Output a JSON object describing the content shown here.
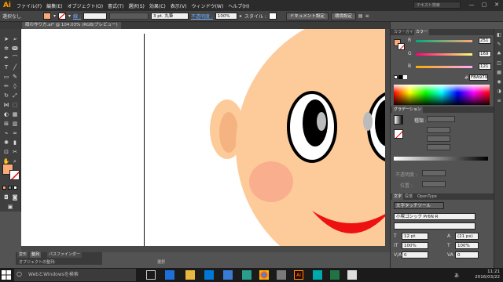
{
  "app": {
    "logo": "Ai"
  },
  "menubar": {
    "items": [
      "ファイル(F)",
      "編集(E)",
      "オブジェクト(O)",
      "書式(T)",
      "選択(S)",
      "効果(C)",
      "表示(V)",
      "ウィンドウ(W)",
      "ヘルプ(H)"
    ],
    "search_placeholder": "テキスト検索",
    "win_controls": [
      "—",
      "▢",
      "✕"
    ]
  },
  "control_bar": {
    "selection_label": "選択なし",
    "stroke_label": "線 :",
    "stroke_style": "3 pt. 丸筆",
    "opacity_label": "不透明度 :",
    "opacity_value": "100%",
    "style_label": "スタイル :",
    "doc_setup_button": "ドキュメント設定",
    "preferences_button": "環境設定"
  },
  "document_tab": {
    "label": "顔の作り方.ai* @ 104.03% (RGB/プレビュー)"
  },
  "color_panel": {
    "tabs": [
      "カラーガイド",
      "カラー"
    ],
    "r_label": "R",
    "r_value": "251",
    "g_label": "G",
    "g_value": "169",
    "b_label": "B",
    "b_value": "121",
    "hex_label": "#",
    "hex_value": "FBA979",
    "fill_color": "#FBA979"
  },
  "gradient_panel": {
    "tabs": [
      "グラデーション"
    ],
    "type_label": "種類 :",
    "opacity_label": "不透明度 :",
    "position_label": "位置 :"
  },
  "character_panel": {
    "tabs": [
      "文字",
      "段落",
      "OpenType"
    ],
    "touch_tool": "文字タッチツール",
    "font_name": "小塚ゴシック Pr6N R",
    "font_style": "",
    "font_size": "12 pt",
    "leading": "(21 px)",
    "h_scale": "100%",
    "v_scale": "100%",
    "tracking": "0",
    "kerning": "0"
  },
  "bottom_panels": {
    "tabs": [
      "変形",
      "整列",
      "パスファインダー"
    ],
    "hint": "オブジェクトの整列:"
  },
  "status": {
    "label": "選択"
  },
  "taskbar": {
    "search_placeholder": "WebとWindowsを検索",
    "time": "11:21",
    "date": "2016/03/22",
    "lang": "あ"
  },
  "colors": {
    "skin": "#FDCB9A",
    "ear_inner": "#F5B382",
    "cheek": "#F8A98C",
    "mouth": "#EE1111",
    "accent_orange": "#FF9A00"
  }
}
